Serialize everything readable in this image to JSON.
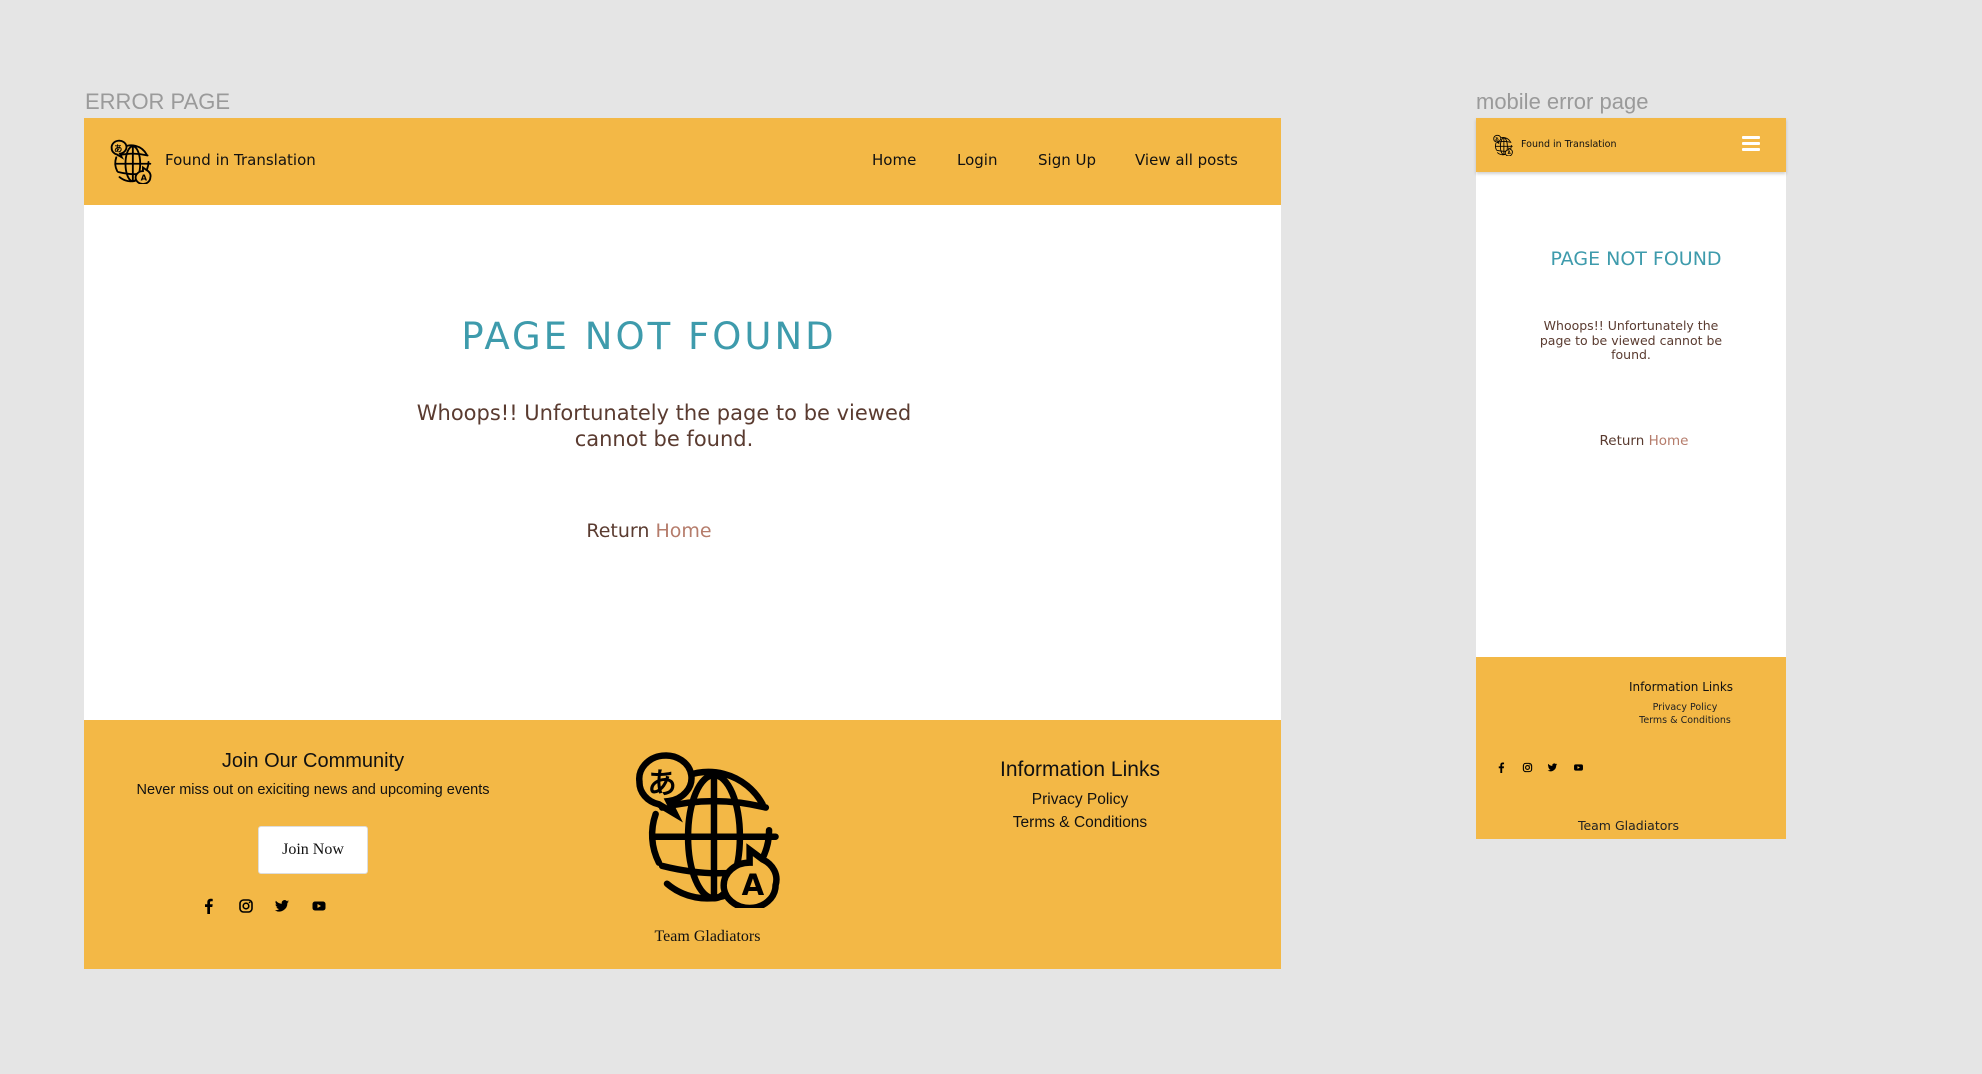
{
  "labels": {
    "desktop": "ERROR PAGE",
    "mobile": "mobile error page"
  },
  "colors": {
    "brand_yellow": "#f3b846",
    "title_teal": "#3e9bac",
    "text_brown": "#5a3b30",
    "link_rose": "#b57c6b",
    "canvas": "#e5e5e5"
  },
  "header": {
    "brand": "Found in Translation",
    "logo_icon": "globe-translate-icon",
    "nav": [
      {
        "label": "Home"
      },
      {
        "label": "Login"
      },
      {
        "label": "Sign Up"
      },
      {
        "label": "View all posts"
      }
    ],
    "menu_icon": "hamburger-menu-icon"
  },
  "main": {
    "title": "PAGE NOT FOUND",
    "message": "Whoops!! Unfortunately the page to be viewed cannot be found.",
    "return_prefix": "Return",
    "return_link": "Home"
  },
  "footer": {
    "community": {
      "title": "Join Our Community",
      "subtitle": "Never miss out on exiciting news and upcoming events",
      "button": "Join Now"
    },
    "socials": [
      {
        "icon": "facebook-icon"
      },
      {
        "icon": "instagram-icon"
      },
      {
        "icon": "twitter-icon"
      },
      {
        "icon": "youtube-icon"
      }
    ],
    "team": "Team Gladiators",
    "info": {
      "title": "Information Links",
      "links": [
        {
          "label": "Privacy Policy"
        },
        {
          "label": "Terms & Conditions"
        }
      ]
    }
  }
}
